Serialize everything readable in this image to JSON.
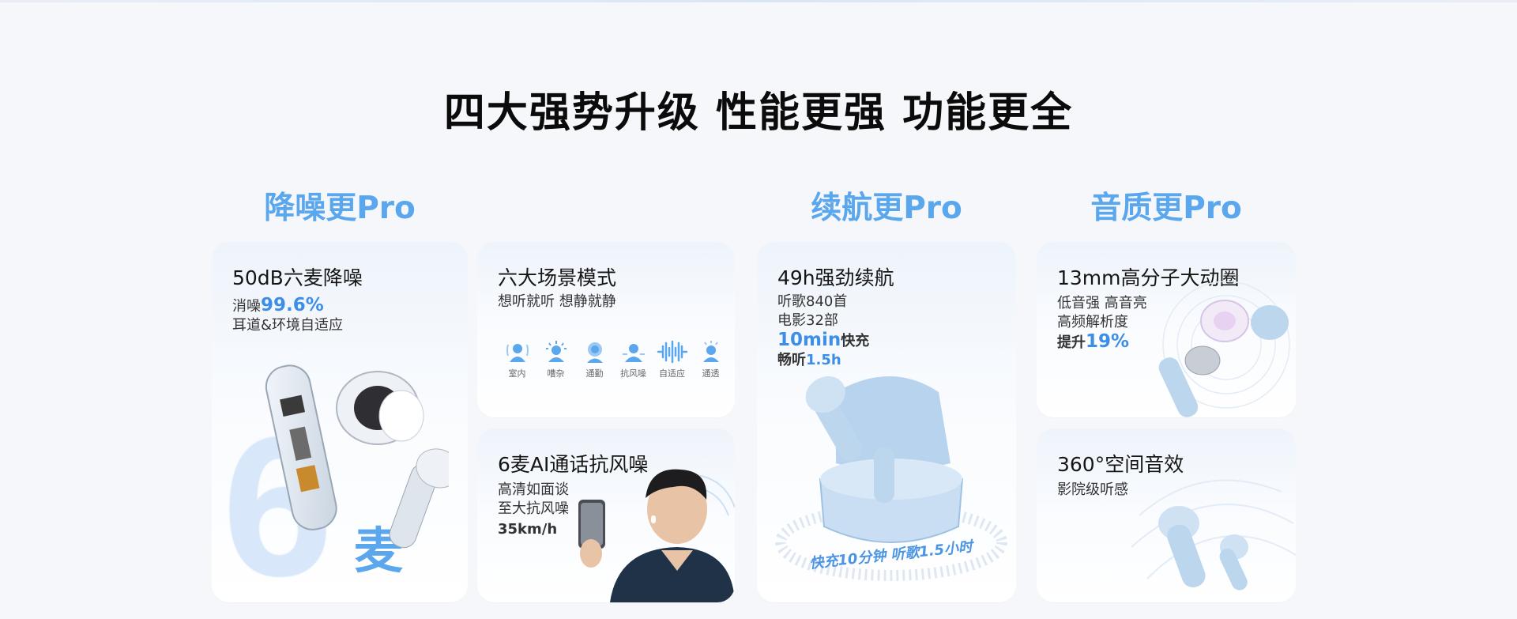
{
  "page": {
    "title": "四大强势升级  性能更强 功能更全"
  },
  "sections": {
    "noise": "降噪更Pro",
    "battery": "续航更Pro",
    "sound": "音质更Pro"
  },
  "cards": {
    "anc": {
      "title": "50dB六麦降噪",
      "line1_prefix": "消噪",
      "line1_value": "99.6%",
      "line2": "耳道&环境自适应",
      "big_digit": "6",
      "big_char": "麦"
    },
    "modes": {
      "title": "六大场景模式",
      "subtitle": "想听就听 想静就静",
      "items": [
        {
          "label": "室内",
          "icon": "indoor-icon"
        },
        {
          "label": "嘈杂",
          "icon": "noisy-icon"
        },
        {
          "label": "通勤",
          "icon": "commute-icon"
        },
        {
          "label": "抗风噪",
          "icon": "wind-icon"
        },
        {
          "label": "自适应",
          "icon": "adaptive-icon"
        },
        {
          "label": "通透",
          "icon": "transparent-icon"
        }
      ]
    },
    "calls": {
      "title": "6麦AI通话抗风噪",
      "line1": "高清如面谈",
      "line2": "至大抗风噪",
      "line3": "35km/h"
    },
    "battery": {
      "title": "49h强劲续航",
      "line1": "听歌840首",
      "line2": "电影32部",
      "line3_value": "10min",
      "line3_suffix": "快充",
      "line4_prefix": "畅听",
      "line4_value": "1.5h",
      "badge": "快充10分钟  听歌1.5小时"
    },
    "driver": {
      "title": "13mm高分子大动圈",
      "line1": "低音强 高音亮",
      "line2": "高频解析度",
      "line3_prefix": "提升",
      "line3_value": "19%"
    },
    "spatial": {
      "title": "360°空间音效",
      "line1": "影院级听感"
    }
  },
  "colors": {
    "accent": "#3d8ee6",
    "section": "#5aa7ee",
    "background": "#f6f7fa",
    "earbud": "#bcd6ee"
  }
}
